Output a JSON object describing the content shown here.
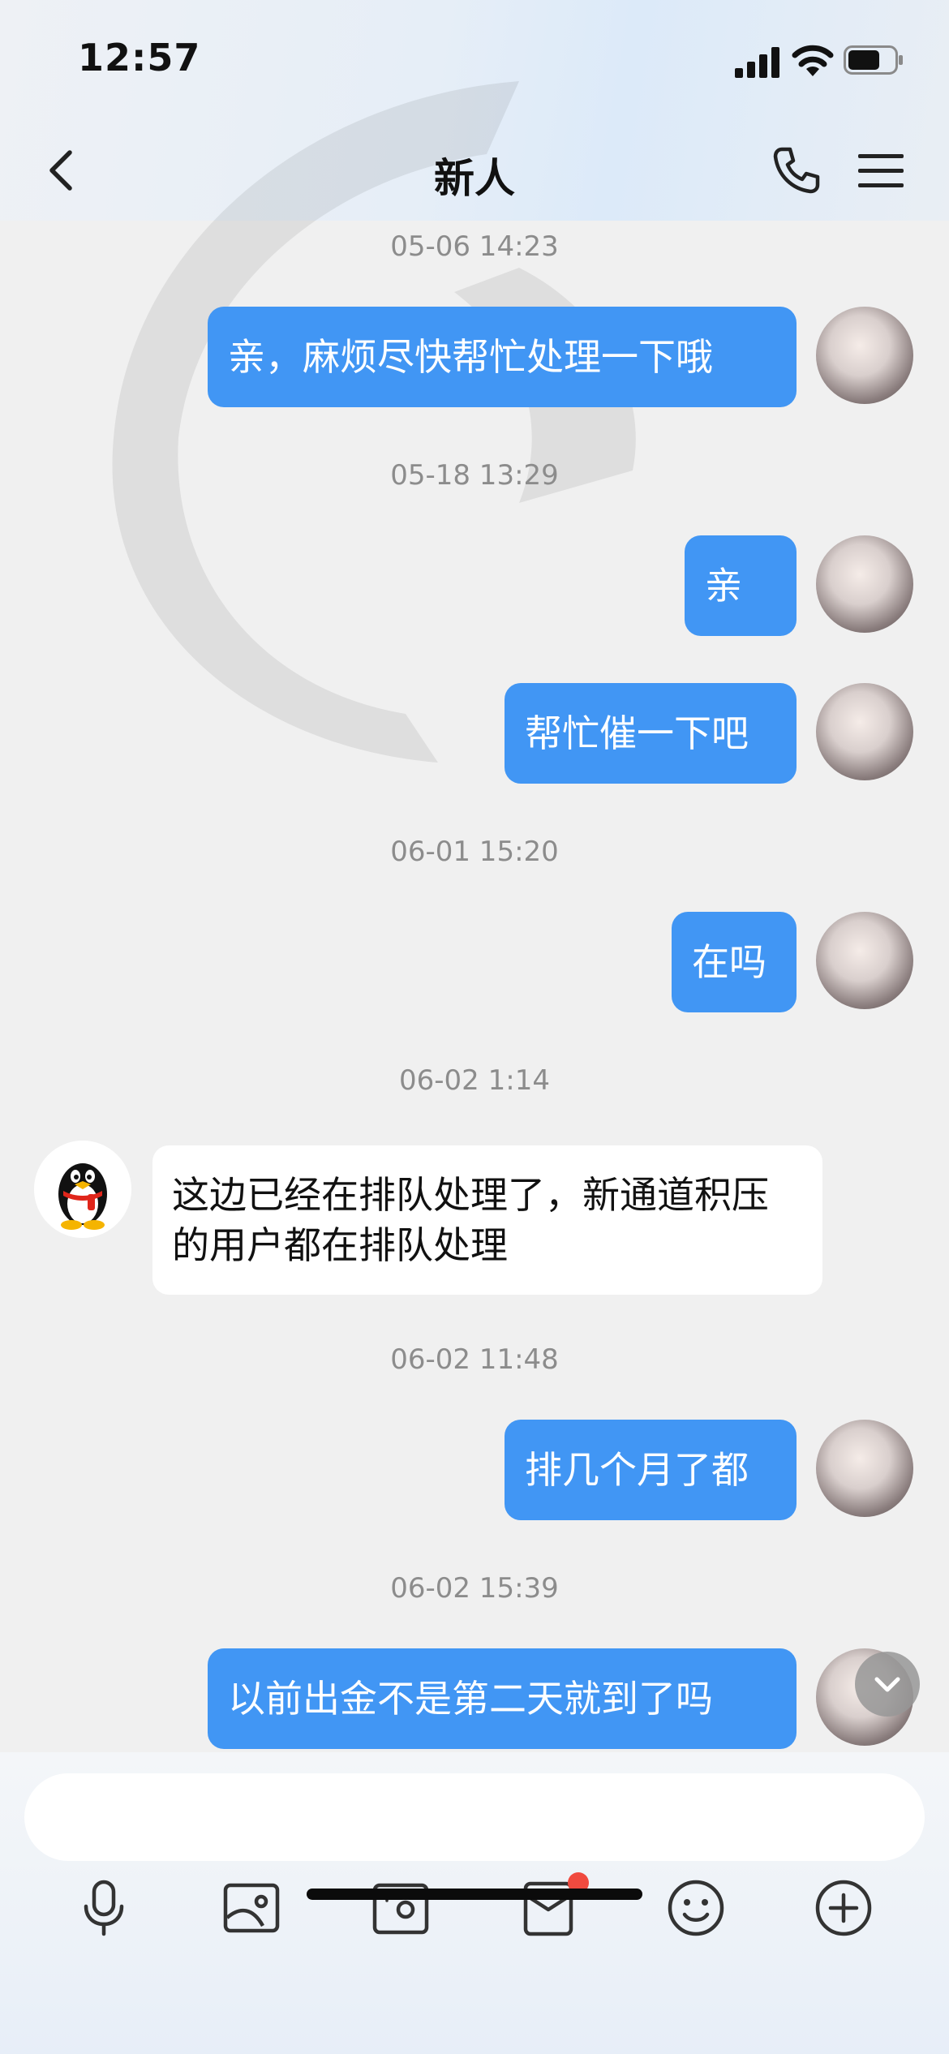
{
  "status_bar": {
    "time": "12:57"
  },
  "header": {
    "title": "新人",
    "icons": [
      "back-icon",
      "phone-icon",
      "menu-icon"
    ]
  },
  "messages": [
    {
      "timestamp": "05-06 14:23"
    },
    {
      "from": "me",
      "text": "亲，麻烦尽快帮忙处理一下哦"
    },
    {
      "timestamp": "05-18 13:29"
    },
    {
      "from": "me",
      "text": "亲"
    },
    {
      "from": "me",
      "text": "帮忙催一下吧"
    },
    {
      "timestamp": "06-01 15:20"
    },
    {
      "from": "me",
      "text": "在吗"
    },
    {
      "timestamp": "06-02 1:14"
    },
    {
      "from": "other",
      "text": "这边已经在排队处理了，新通道积压的用户都在排队处理"
    },
    {
      "timestamp": "06-02 11:48"
    },
    {
      "from": "me",
      "text": "排几个月了都"
    },
    {
      "timestamp": "06-02 15:39"
    },
    {
      "from": "me",
      "text": "以前出金不是第二天就到了吗"
    }
  ],
  "composer": {
    "placeholder": "",
    "tools": [
      "microphone-icon",
      "image-icon",
      "camera-icon",
      "red-packet-icon",
      "emoji-icon",
      "plus-icon"
    ],
    "red_packet_has_notification": true
  },
  "colors": {
    "outgoing_bubble": "#4196f4",
    "incoming_bubble": "#ffffff",
    "background": "#f0f0f0",
    "badge": "#f04a3f"
  }
}
